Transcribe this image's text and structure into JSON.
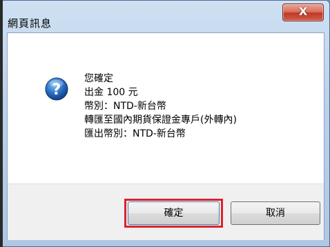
{
  "dialog": {
    "title": "網頁訊息",
    "close_label": "X",
    "icon": "question-icon",
    "message_lines": [
      "您確定",
      "出金 100 元",
      "幣別：NTD-新台幣",
      "轉匯至國內期貨保證金專戶(外轉內)",
      "匯出幣別：NTD-新台幣"
    ],
    "ok_label": "確定",
    "cancel_label": "取消"
  },
  "colors": {
    "highlight": "#e0202c",
    "close_button": "#c0392b",
    "question_icon": "#1f5fa8"
  }
}
